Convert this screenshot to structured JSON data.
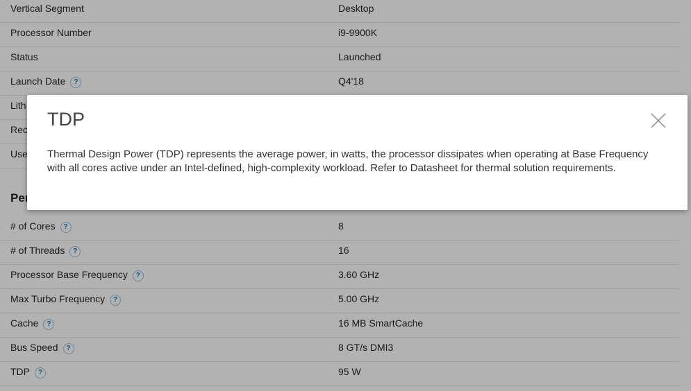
{
  "specs_top": [
    {
      "label": "Vertical Segment",
      "value": "Desktop",
      "help": false
    },
    {
      "label": "Processor Number",
      "value": "i9-9900K",
      "help": false
    },
    {
      "label": "Status",
      "value": "Launched",
      "help": false
    },
    {
      "label": "Launch Date",
      "value": "Q4'18",
      "help": true
    },
    {
      "label": "Lith",
      "value": "",
      "help": false
    },
    {
      "label": "Rec",
      "value": "",
      "help": false
    },
    {
      "label": "Use",
      "value": "",
      "help": false
    }
  ],
  "section_partial": "Per",
  "specs_performance": [
    {
      "label": "# of Cores",
      "value": "8",
      "help": true
    },
    {
      "label": "# of Threads",
      "value": "16",
      "help": true
    },
    {
      "label": "Processor Base Frequency",
      "value": "3.60 GHz",
      "help": true
    },
    {
      "label": "Max Turbo Frequency",
      "value": "5.00 GHz",
      "help": true
    },
    {
      "label": "Cache",
      "value": "16 MB SmartCache",
      "help": true
    },
    {
      "label": "Bus Speed",
      "value": "8 GT/s DMI3",
      "help": true
    },
    {
      "label": "TDP",
      "value": "95 W",
      "help": true
    }
  ],
  "help_glyph": "?",
  "modal": {
    "title": "TDP",
    "body": "Thermal Design Power (TDP) represents the average power, in watts, the processor dissipates when operating at Base Frequency with all cores active under an Intel-defined, high-complexity workload. Refer to Datasheet for thermal solution requirements.",
    "close_icon": "close-icon"
  }
}
